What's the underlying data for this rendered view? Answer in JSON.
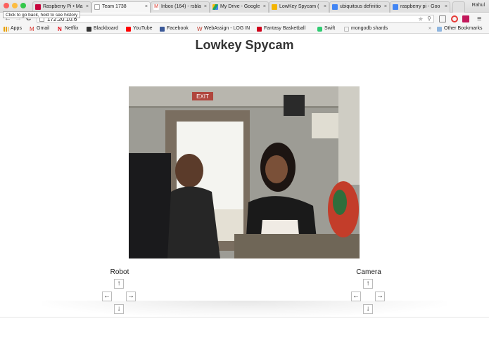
{
  "tooltip": "Click to go back, hold to see history",
  "tabs": [
    {
      "label": "Raspberry Pi • Ma",
      "active": false,
      "icon_color": "#c7053d"
    },
    {
      "label": "Team 1738",
      "active": true,
      "icon_color": "#cccccc"
    },
    {
      "label": "Inbox (164) - rsbla",
      "active": false,
      "icon_color": "#d93025"
    },
    {
      "label": "My Drive - Google",
      "active": false,
      "icon_color": "#1fa463"
    },
    {
      "label": "LowKey Spycam (",
      "active": false,
      "icon_color": "#f4b400"
    },
    {
      "label": "ubiquitous definitio",
      "active": false,
      "icon_color": "#4285f4"
    },
    {
      "label": "raspberry pi - Goo",
      "active": false,
      "icon_color": "#4285f4"
    }
  ],
  "user_name": "Rahul",
  "address": {
    "url": "172.20.10.6"
  },
  "bookmarks": {
    "items": [
      {
        "label": "Apps",
        "icon_color": "#e8a000"
      },
      {
        "label": "Gmail",
        "icon_color": "#d93025"
      },
      {
        "label": "Netflix",
        "icon_color": "#e50914"
      },
      {
        "label": "Blackboard",
        "icon_color": "#333333"
      },
      {
        "label": "YouTube",
        "icon_color": "#ff0000"
      },
      {
        "label": "Facebook",
        "icon_color": "#3b5998"
      },
      {
        "label": "WebAssign - LOG IN",
        "icon_color": "#c0392b"
      },
      {
        "label": "Fantasy Basketball",
        "icon_color": "#d0021b"
      },
      {
        "label": "Swift",
        "icon_color": "#2ecc71"
      },
      {
        "label": "mongodb shards",
        "icon_color": "#cccccc"
      }
    ],
    "overflow": "»",
    "other": "Other Bookmarks"
  },
  "page": {
    "title": "Lowkey Spycam",
    "feed_sign": "EXIT",
    "robot_label": "Robot",
    "camera_label": "Camera",
    "arrows": {
      "up": "↑",
      "left": "←",
      "right": "→",
      "down": "↓"
    }
  }
}
